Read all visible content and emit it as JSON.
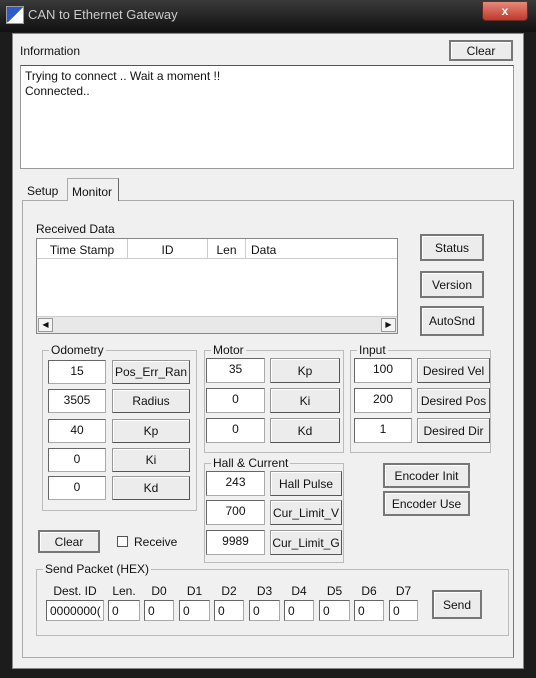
{
  "window": {
    "title": "CAN to Ethernet Gateway",
    "close": "x"
  },
  "info": {
    "label": "Information",
    "clear": "Clear",
    "lines": [
      "Trying to connect .. Wait a moment !!",
      "Connected.."
    ]
  },
  "tabs": [
    {
      "label": "Setup"
    },
    {
      "label": "Monitor",
      "selected": true
    }
  ],
  "received": {
    "label": "Received Data",
    "columns": [
      "Time Stamp",
      "ID",
      "Len",
      "Data"
    ],
    "rows": []
  },
  "side_buttons": [
    "Status",
    "Version",
    "AutoSnd"
  ],
  "odometry": {
    "label": "Odometry",
    "rows": [
      {
        "value": "15",
        "button": "Pos_Err_Ran"
      },
      {
        "value": "3505",
        "button": "Radius"
      },
      {
        "value": "40",
        "button": "Kp"
      },
      {
        "value": "0",
        "button": "Ki"
      },
      {
        "value": "0",
        "button": "Kd"
      }
    ]
  },
  "motor": {
    "label": "Motor",
    "rows": [
      {
        "value": "35",
        "button": "Kp"
      },
      {
        "value": "0",
        "button": "Ki"
      },
      {
        "value": "0",
        "button": "Kd"
      }
    ]
  },
  "input": {
    "label": "Input",
    "rows": [
      {
        "value": "100",
        "button": "Desired Vel"
      },
      {
        "value": "200",
        "button": "Desired Pos"
      },
      {
        "value": "1",
        "button": "Desired Dir"
      }
    ]
  },
  "hall": {
    "label": "Hall & Current",
    "rows": [
      {
        "value": "243",
        "button": "Hall Pulse"
      },
      {
        "value": "700",
        "button": "Cur_Limit_V"
      },
      {
        "value": "9989",
        "button": "Cur_Limit_G"
      }
    ]
  },
  "encoder": {
    "init": "Encoder Init",
    "use": "Encoder Use"
  },
  "bottom": {
    "clear": "Clear",
    "receive": "Receive",
    "receive_checked": false
  },
  "send": {
    "label": "Send Packet (HEX)",
    "fields": [
      {
        "label": "Dest. ID",
        "value": "0000000("
      },
      {
        "label": "Len.",
        "value": "0"
      },
      {
        "label": "D0",
        "value": "0"
      },
      {
        "label": "D1",
        "value": "0"
      },
      {
        "label": "D2",
        "value": "0"
      },
      {
        "label": "D3",
        "value": "0"
      },
      {
        "label": "D4",
        "value": "0"
      },
      {
        "label": "D5",
        "value": "0"
      },
      {
        "label": "D6",
        "value": "0"
      },
      {
        "label": "D7",
        "value": "0"
      }
    ],
    "button": "Send"
  }
}
